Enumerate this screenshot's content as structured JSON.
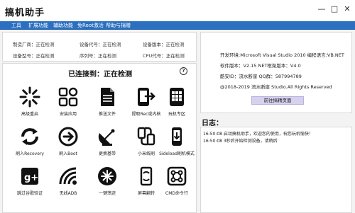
{
  "window": {
    "title": "搞机助手",
    "controls": [
      "—",
      "□",
      "✕"
    ]
  },
  "menu": [
    "工具",
    "扩展功能",
    "辅助功能",
    "免Root激活",
    "帮助与捐赠"
  ],
  "device_info": {
    "manufacturer": "制造厂商：正在检测",
    "model": "设备代号：正在检测",
    "version": "设备版本：正在检测",
    "device_model": "设备型号：正在检测",
    "serial": "序列号：正在检测",
    "cpu": "CPU代号：正在检测"
  },
  "connection": {
    "status": "已连接到：正在检测",
    "help": "?"
  },
  "tools": [
    {
      "label": "高级重启",
      "icon": "loading-spinner-icon"
    },
    {
      "label": "安装应用",
      "icon": "app-grid-icon"
    },
    {
      "label": "推送文件",
      "icon": "document-icon"
    },
    {
      "label": "提取Rec或内核",
      "icon": "phone-export-icon"
    },
    {
      "label": "玩机专区",
      "icon": "tablet-grid-icon"
    },
    {
      "label": "刷入Recovery",
      "icon": "sync-arrows-icon"
    },
    {
      "label": "刷入Boot",
      "icon": "circle-arrow-icon"
    },
    {
      "label": "更换基带",
      "icon": "satellite-dish-icon"
    },
    {
      "label": "小米线刷",
      "icon": "usb-cable-icon"
    },
    {
      "label": "Sideload刷机模式",
      "icon": "phone-sideload-icon"
    },
    {
      "label": "跳过谷歌验证",
      "icon": "google-plus-icon"
    },
    {
      "label": "无线ADB",
      "icon": "wifi-signal-icon"
    },
    {
      "label": "一键荡迹",
      "icon": "snowflake-icon"
    },
    {
      "label": "屏幕翻转",
      "icon": "screen-rotate-icon"
    },
    {
      "label": "CMD命令行",
      "icon": "terminal-icon"
    }
  ],
  "about": {
    "line1": "开发环境:Microsoft Visual Studio 2010   编程语言:VB.NET",
    "line2": "软件版本：V2.15        NET框架版本：V4.0",
    "line3": "酷安ID：流水断崖        QQ群：587994789",
    "line4": "@2018-2019  流水断崖 Studio.All Rights Reserved",
    "qq_button": "前往搞精页面"
  },
  "log": {
    "title": "日志：",
    "lines": [
      "16:50:08 启动搞机助手，欢迎您的使用，祝您玩机愉快！",
      "16:50:08 3秒后开始检测设备，请稍后"
    ]
  },
  "colors": {
    "menubar": "#2a6fc0",
    "button": "#d6d2ee",
    "background": "#f3f3f3"
  }
}
